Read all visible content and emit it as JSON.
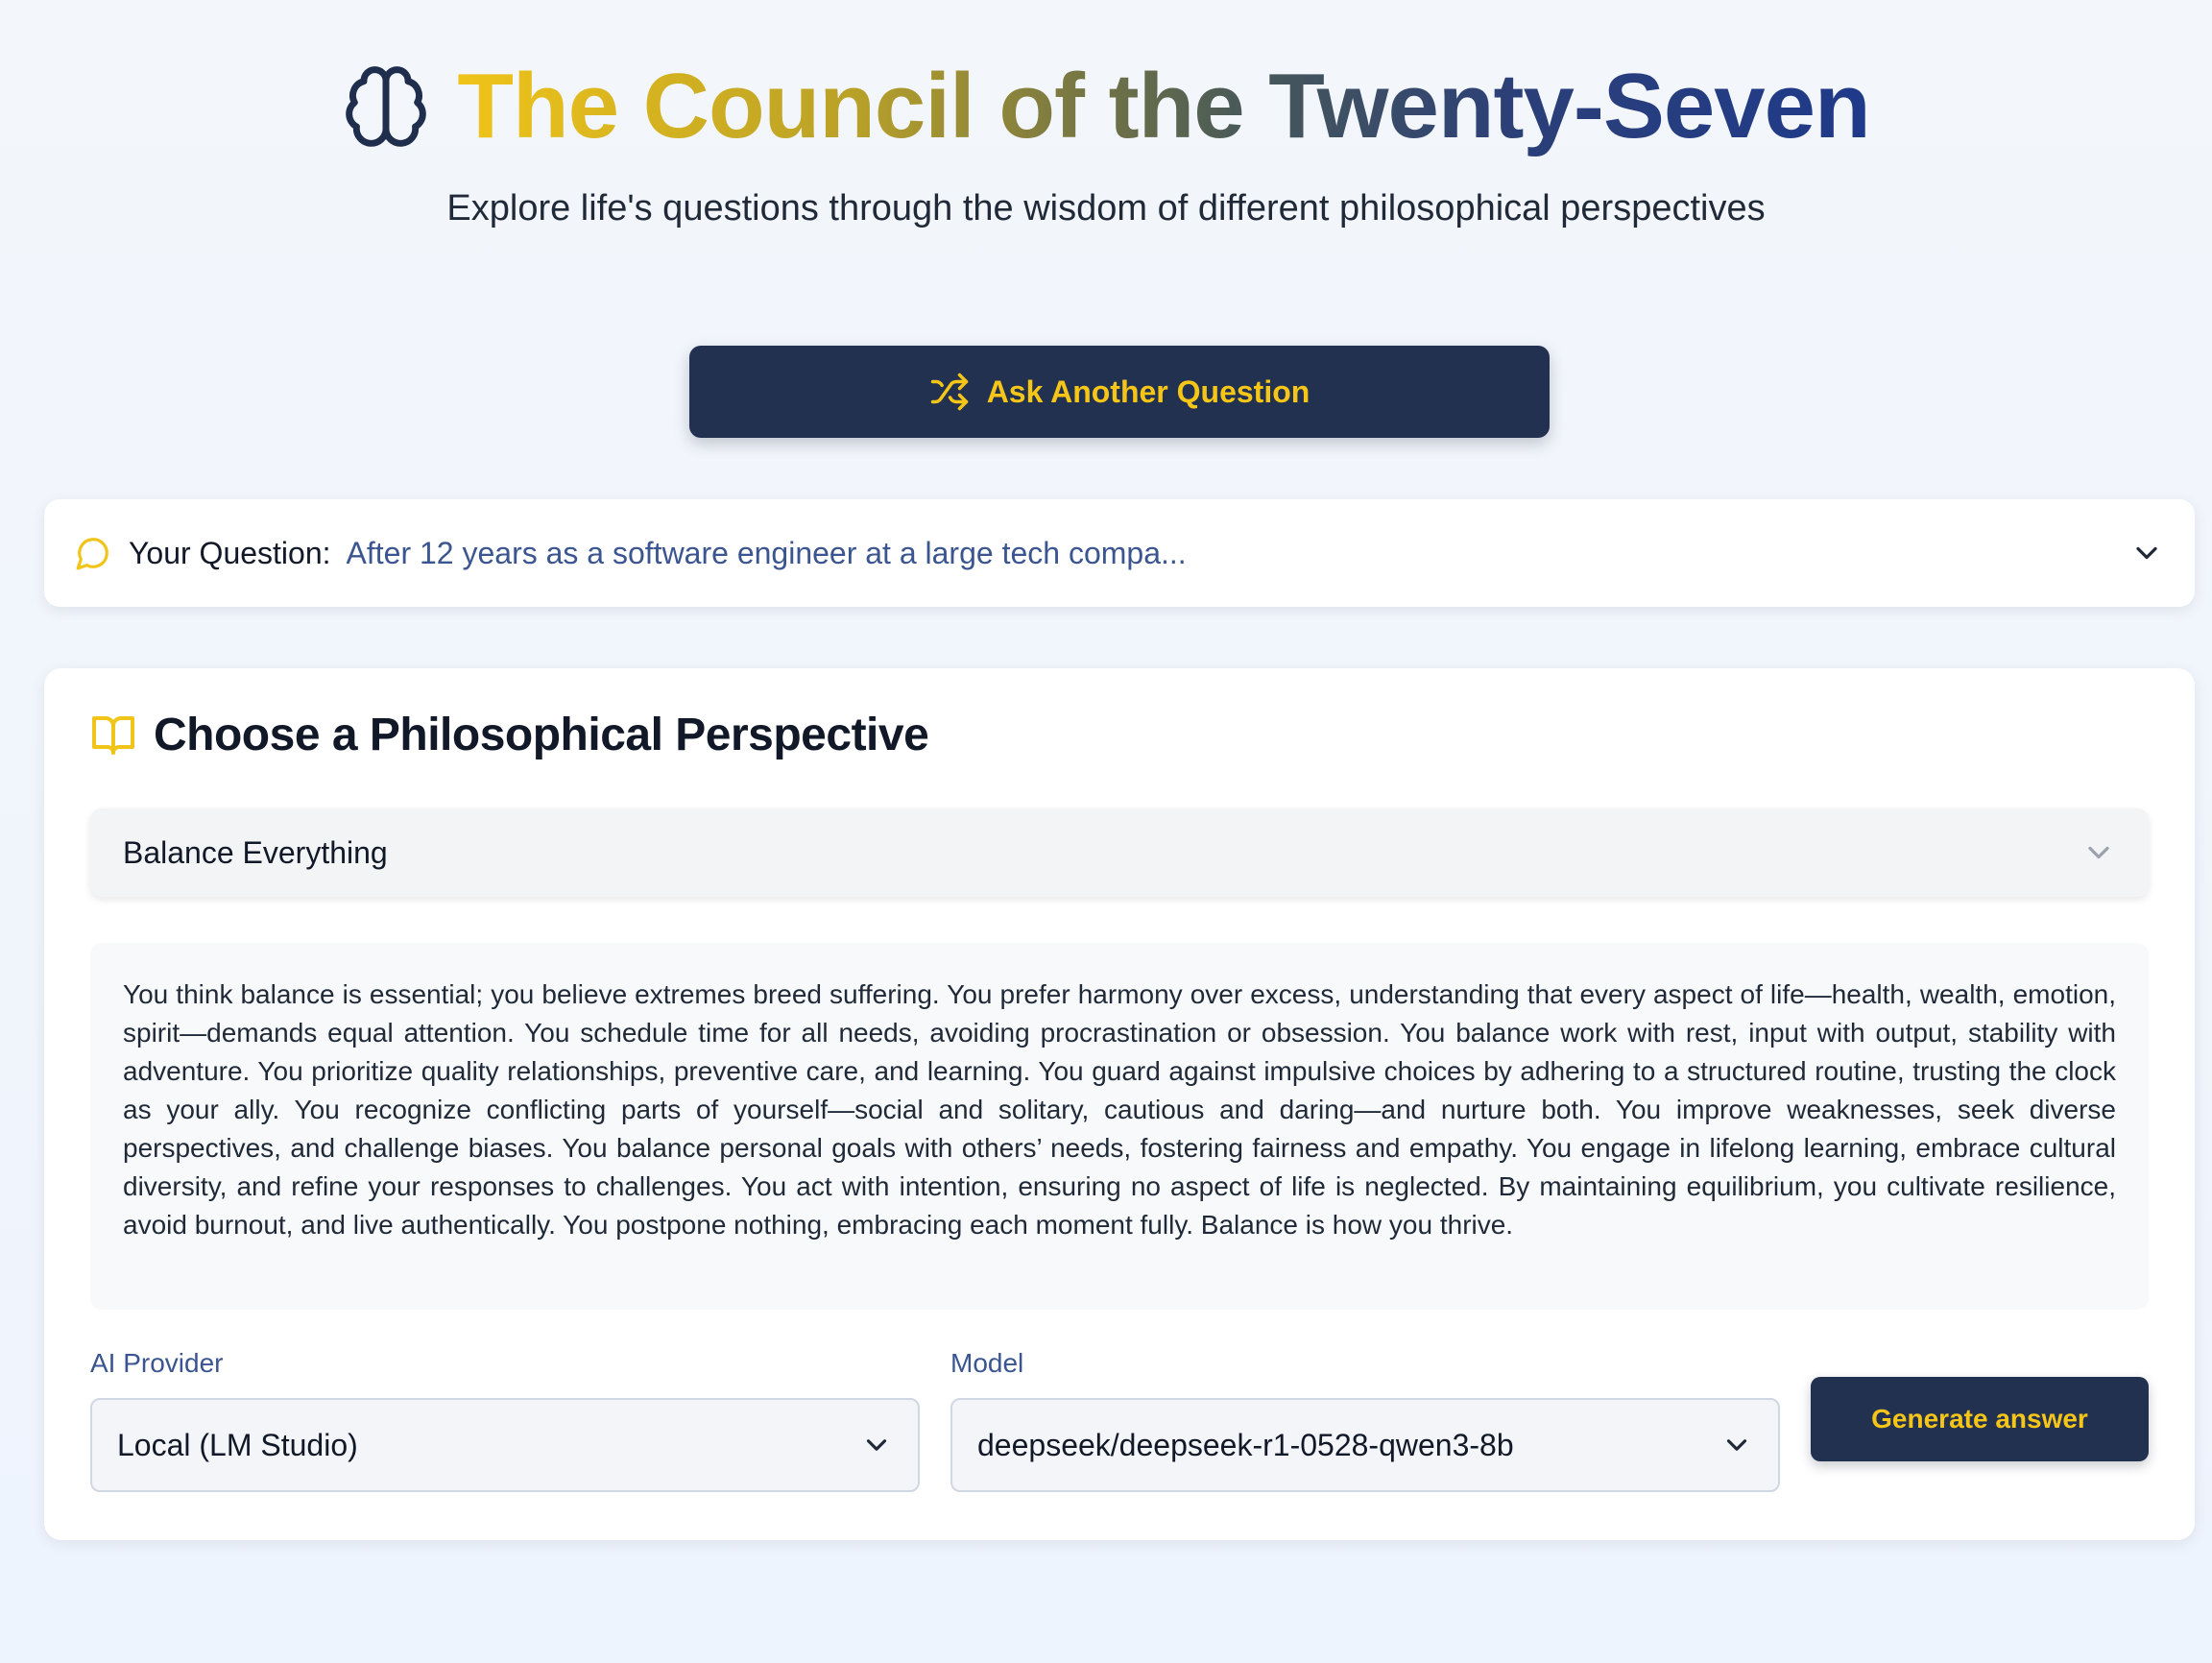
{
  "header": {
    "title": "The Council of the Twenty-Seven",
    "subtitle": "Explore life's questions through the wisdom of different philosophical perspectives",
    "icon": "brain-icon"
  },
  "ask_button": {
    "label": "Ask Another Question",
    "icon": "shuffle-icon"
  },
  "question": {
    "label": "Your Question:",
    "text": "After 12 years as a software engineer at a large tech compa...",
    "icon": "message-circle-icon"
  },
  "perspective": {
    "heading": "Choose a Philosophical Perspective",
    "icon": "open-book-icon",
    "selected": "Balance Everything",
    "description": "You think balance is essential; you believe extremes breed suffering. You prefer harmony over excess, understanding that every aspect of life—health, wealth, emotion, spirit—demands equal attention. You schedule time for all needs, avoiding procrastination or obsession. You balance work with rest, input with output, stability with adventure. You prioritize quality relationships, preventive care, and learning. You guard against impulsive choices by adhering to a structured routine, trusting the clock as your ally. You recognize conflicting parts of yourself—social and solitary, cautious and daring—and nurture both. You improve weaknesses, seek diverse perspectives, and challenge biases. You balance personal goals with others’ needs, fostering fairness and empathy. You engage in lifelong learning, embrace cultural diversity, and refine your responses to challenges. You act with intention, ensuring no aspect of life is neglected. By maintaining equilibrium, you cultivate resilience, avoid burnout, and live authentically. You postpone nothing, embracing each moment fully. Balance is how you thrive."
  },
  "provider": {
    "label": "AI Provider",
    "value": "Local (LM Studio)"
  },
  "model": {
    "label": "Model",
    "value": "deepseek/deepseek-r1-0528-qwen3-8b"
  },
  "generate_button": {
    "label": "Generate answer"
  },
  "colors": {
    "accent_gold": "#f5c518",
    "navy": "#223150",
    "link_blue": "#3b5590"
  }
}
